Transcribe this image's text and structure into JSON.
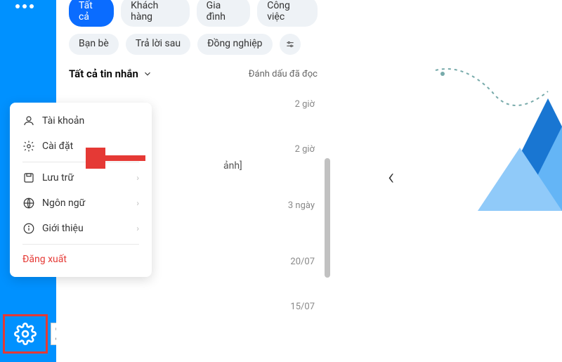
{
  "sidebar": {
    "tooltip": "Cài đặt"
  },
  "chips": {
    "row1": [
      {
        "label": "Tất cả",
        "active": true
      },
      {
        "label": "Khách hàng",
        "active": false
      },
      {
        "label": "Gia đình",
        "active": false
      },
      {
        "label": "Công việc",
        "active": false
      }
    ],
    "row2": [
      {
        "label": "Bạn bè"
      },
      {
        "label": "Trả lời sau"
      },
      {
        "label": "Đồng nghiệp"
      }
    ]
  },
  "header": {
    "title": "Tất cả tin nhắn",
    "mark_read": "Đánh dấu đã đọc"
  },
  "messages": [
    {
      "time": "2 giờ"
    },
    {
      "time": "2 giờ"
    },
    {
      "time": "3 ngày"
    },
    {
      "time": "20/07"
    },
    {
      "time": "15/07"
    }
  ],
  "partial_text": "ảnh]",
  "menu": {
    "account": "Tài khoản",
    "settings": "Cài đặt",
    "storage": "Lưu trữ",
    "language": "Ngôn ngữ",
    "about": "Giới thiệu",
    "logout": "Đăng xuất"
  }
}
